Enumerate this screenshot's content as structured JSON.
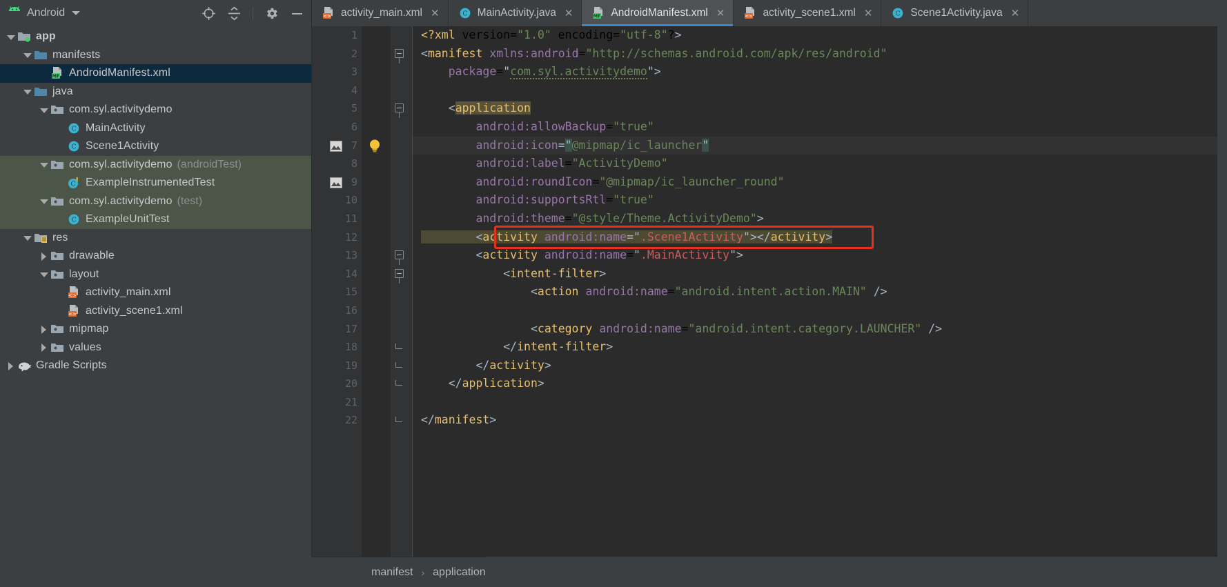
{
  "project_panel": {
    "title": "Android",
    "title_icon": "android-robot-icon",
    "dropdown_icon": "chevron-down-icon",
    "toolbar": [
      {
        "name": "locate-target-icon",
        "tooltip": "Select Opened File"
      },
      {
        "name": "collapse-all-icon",
        "tooltip": "Collapse All"
      },
      {
        "name": "gear-icon",
        "tooltip": "Settings"
      },
      {
        "name": "minimize-icon",
        "tooltip": "Hide"
      }
    ],
    "tree": [
      {
        "label": "app",
        "suffix": "",
        "depth": 0,
        "arrow": "down",
        "icon": "module-folder-icon",
        "bold": true,
        "state": "normal"
      },
      {
        "label": "manifests",
        "suffix": "",
        "depth": 1,
        "arrow": "down",
        "icon": "folder-icon",
        "bold": false,
        "state": "normal"
      },
      {
        "label": "AndroidManifest.xml",
        "suffix": "",
        "depth": 2,
        "arrow": "none",
        "icon": "manifest-file-icon",
        "bold": false,
        "state": "selected"
      },
      {
        "label": "java",
        "suffix": "",
        "depth": 1,
        "arrow": "down",
        "icon": "folder-icon",
        "bold": false,
        "state": "normal"
      },
      {
        "label": "com.syl.activitydemo",
        "suffix": "",
        "depth": 2,
        "arrow": "down",
        "icon": "package-icon",
        "bold": false,
        "state": "normal"
      },
      {
        "label": "MainActivity",
        "suffix": "",
        "depth": 3,
        "arrow": "none",
        "icon": "java-class-icon",
        "bold": false,
        "state": "normal"
      },
      {
        "label": "Scene1Activity",
        "suffix": "",
        "depth": 3,
        "arrow": "none",
        "icon": "java-class-icon",
        "bold": false,
        "state": "normal"
      },
      {
        "label": "com.syl.activitydemo",
        "suffix": "(androidTest)",
        "depth": 2,
        "arrow": "down",
        "icon": "package-icon",
        "bold": false,
        "state": "test"
      },
      {
        "label": "ExampleInstrumentedTest",
        "suffix": "",
        "depth": 3,
        "arrow": "none",
        "icon": "java-test-class-icon",
        "bold": false,
        "state": "test"
      },
      {
        "label": "com.syl.activitydemo",
        "suffix": "(test)",
        "depth": 2,
        "arrow": "down",
        "icon": "package-icon",
        "bold": false,
        "state": "test"
      },
      {
        "label": "ExampleUnitTest",
        "suffix": "",
        "depth": 3,
        "arrow": "none",
        "icon": "java-class-icon",
        "bold": false,
        "state": "test"
      },
      {
        "label": "res",
        "suffix": "",
        "depth": 1,
        "arrow": "down",
        "icon": "res-folder-icon",
        "bold": false,
        "state": "normal"
      },
      {
        "label": "drawable",
        "suffix": "",
        "depth": 2,
        "arrow": "right",
        "icon": "package-icon",
        "bold": false,
        "state": "normal"
      },
      {
        "label": "layout",
        "suffix": "",
        "depth": 2,
        "arrow": "down",
        "icon": "package-icon",
        "bold": false,
        "state": "normal"
      },
      {
        "label": "activity_main.xml",
        "suffix": "",
        "depth": 3,
        "arrow": "none",
        "icon": "xml-layout-file-icon",
        "bold": false,
        "state": "normal"
      },
      {
        "label": "activity_scene1.xml",
        "suffix": "",
        "depth": 3,
        "arrow": "none",
        "icon": "xml-layout-file-icon",
        "bold": false,
        "state": "normal"
      },
      {
        "label": "mipmap",
        "suffix": "",
        "depth": 2,
        "arrow": "right",
        "icon": "package-icon",
        "bold": false,
        "state": "normal"
      },
      {
        "label": "values",
        "suffix": "",
        "depth": 2,
        "arrow": "right",
        "icon": "package-icon",
        "bold": false,
        "state": "normal"
      },
      {
        "label": "Gradle Scripts",
        "suffix": "",
        "depth": 0,
        "arrow": "right",
        "icon": "gradle-elephant-icon",
        "bold": false,
        "state": "normal"
      }
    ]
  },
  "editor_tabs": [
    {
      "label": "activity_main.xml",
      "icon": "xml-layout-file-icon",
      "active": false,
      "close_icon": "close-icon"
    },
    {
      "label": "MainActivity.java",
      "icon": "java-class-icon",
      "active": false,
      "close_icon": "close-icon"
    },
    {
      "label": "AndroidManifest.xml",
      "icon": "manifest-file-icon",
      "active": true,
      "close_icon": "close-icon"
    },
    {
      "label": "activity_scene1.xml",
      "icon": "xml-layout-file-icon",
      "active": false,
      "close_icon": "close-icon"
    },
    {
      "label": "Scene1Activity.java",
      "icon": "java-class-icon",
      "active": false,
      "close_icon": "close-icon"
    }
  ],
  "editor": {
    "first_line": 1,
    "last_line": 22,
    "gutter_icons": [
      {
        "line": 7,
        "name": "image-resource-icon"
      },
      {
        "line": 9,
        "name": "image-resource-icon"
      }
    ],
    "intention_bulb": {
      "line": 7,
      "name": "intention-bulb-icon"
    },
    "fold_markers": [
      {
        "line": 2,
        "type": "collapse"
      },
      {
        "line": 5,
        "type": "collapse"
      },
      {
        "line": 13,
        "type": "collapse"
      },
      {
        "line": 14,
        "type": "collapse"
      },
      {
        "line": 18,
        "type": "end"
      },
      {
        "line": 19,
        "type": "end"
      },
      {
        "line": 20,
        "type": "end"
      },
      {
        "line": 22,
        "type": "end"
      }
    ],
    "highlight_box": {
      "line": 12,
      "color": "#e8301f",
      "label": "activity-scene1-highlight-box"
    },
    "lines": [
      {
        "n": 1,
        "text": "<?xml version=\"1.0\" encoding=\"utf-8\"?>"
      },
      {
        "n": 2,
        "text": "<manifest xmlns:android=\"http://schemas.android.com/apk/res/android\""
      },
      {
        "n": 3,
        "text": "    package=\"com.syl.activitydemo\">"
      },
      {
        "n": 4,
        "text": ""
      },
      {
        "n": 5,
        "text": "    <application"
      },
      {
        "n": 6,
        "text": "        android:allowBackup=\"true\""
      },
      {
        "n": 7,
        "text": "        android:icon=\"@mipmap/ic_launcher\""
      },
      {
        "n": 8,
        "text": "        android:label=\"ActivityDemo\""
      },
      {
        "n": 9,
        "text": "        android:roundIcon=\"@mipmap/ic_launcher_round\""
      },
      {
        "n": 10,
        "text": "        android:supportsRtl=\"true\""
      },
      {
        "n": 11,
        "text": "        android:theme=\"@style/Theme.ActivityDemo\">"
      },
      {
        "n": 12,
        "text": "        <activity android:name=\".Scene1Activity\"></activity>"
      },
      {
        "n": 13,
        "text": "        <activity android:name=\".MainActivity\">"
      },
      {
        "n": 14,
        "text": "            <intent-filter>"
      },
      {
        "n": 15,
        "text": "                <action android:name=\"android.intent.action.MAIN\" />"
      },
      {
        "n": 16,
        "text": ""
      },
      {
        "n": 17,
        "text": "                <category android:name=\"android.intent.category.LAUNCHER\" />"
      },
      {
        "n": 18,
        "text": "            </intent-filter>"
      },
      {
        "n": 19,
        "text": "        </activity>"
      },
      {
        "n": 20,
        "text": "    </application>"
      },
      {
        "n": 21,
        "text": ""
      },
      {
        "n": 22,
        "text": "</manifest>"
      }
    ]
  },
  "breadcrumb": {
    "items": [
      "manifest",
      "application"
    ],
    "separator": "›"
  },
  "colors": {
    "panel_bg": "#3c3f41",
    "editor_bg": "#2b2b2b",
    "selection_blue": "#0d293e",
    "test_band": "#4b5548",
    "tab_active": "#4e5254",
    "tab_underline": "#3d86d1",
    "highlight_red": "#e8301f",
    "string_green": "#6a8759",
    "tag_yellow": "#e8bf6a",
    "attr_purple": "#9876aa"
  }
}
